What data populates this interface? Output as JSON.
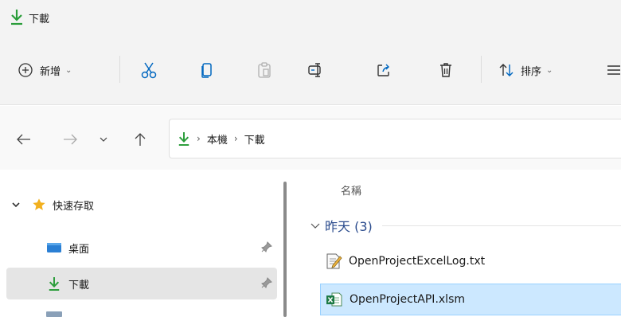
{
  "window": {
    "title": "下載"
  },
  "toolbar": {
    "new_label": "新增",
    "sort_label": "排序",
    "icons": [
      "plus-circle-icon",
      "cut-icon",
      "copy-icon",
      "paste-icon",
      "rename-icon",
      "share-icon",
      "delete-icon",
      "sort-icon",
      "view-menu-icon"
    ]
  },
  "address": {
    "crumbs": [
      "本機",
      "下載"
    ]
  },
  "sidebar": {
    "quick_access": "快速存取",
    "items": [
      {
        "label": "桌面",
        "pinned": true
      },
      {
        "label": "下載",
        "pinned": true,
        "selected": true
      }
    ]
  },
  "content": {
    "column_name": "名稱",
    "group_title": "昨天 (3)",
    "files": [
      {
        "name": "OpenProjectExcelLog.txt",
        "icon": "text-file-icon"
      },
      {
        "name": "OpenProjectAPI.xlsm",
        "icon": "excel-file-icon",
        "selected": true
      }
    ]
  },
  "colors": {
    "accent": "#0067c0",
    "download": "#2a9d3a",
    "star": "#f2b01e",
    "selection": "#cce8ff"
  }
}
